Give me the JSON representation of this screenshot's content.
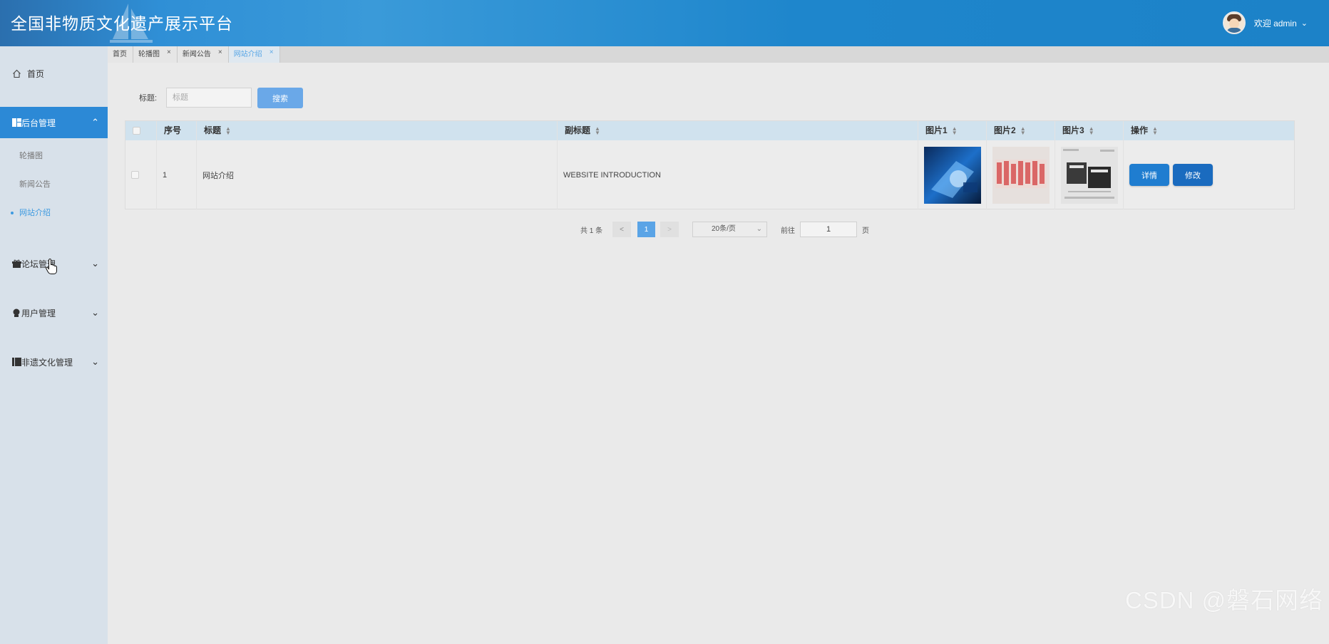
{
  "header": {
    "title": "全国非物质文化遗产展示平台",
    "welcome": "欢迎 admin"
  },
  "sidebar": {
    "home": "首页",
    "groups": [
      {
        "label": "后台管理",
        "expanded": true,
        "icon": "grid-icon",
        "items": [
          "轮播图",
          "新闻公告",
          "网站介绍"
        ]
      },
      {
        "label": "论坛管理",
        "expanded": false,
        "icon": "gift-icon"
      },
      {
        "label": "用户管理",
        "expanded": false,
        "icon": "user-icon"
      },
      {
        "label": "非遗文化管理",
        "expanded": false,
        "icon": "book-icon"
      }
    ],
    "current_item": "网站介绍"
  },
  "tabs": [
    {
      "label": "首页",
      "closable": false,
      "active": false
    },
    {
      "label": "轮播图",
      "closable": true,
      "active": false
    },
    {
      "label": "新闻公告",
      "closable": true,
      "active": false
    },
    {
      "label": "网站介绍",
      "closable": true,
      "active": true
    }
  ],
  "search": {
    "label": "标题:",
    "placeholder": "标题",
    "button": "搜索"
  },
  "table": {
    "columns": [
      "序号",
      "标题",
      "副标题",
      "图片1",
      "图片2",
      "图片3",
      "操作"
    ],
    "rows": [
      {
        "index": "1",
        "title": "网站介绍",
        "subtitle": "WEBSITE INTRODUCTION",
        "actions": {
          "detail": "详情",
          "edit": "修改"
        }
      }
    ]
  },
  "pagination": {
    "total": "共 1 条",
    "prev": "<",
    "current": "1",
    "next": ">",
    "page_size": "20条/页",
    "goto_label": "前往",
    "goto_value": "1",
    "page_suffix": "页"
  },
  "watermark": "CSDN @磐石网络",
  "colors": {
    "header": "#1e86cc",
    "accent": "#2c89d6",
    "sidebar_bg": "#d8e1ea",
    "table_header": "#d0e2ee"
  }
}
